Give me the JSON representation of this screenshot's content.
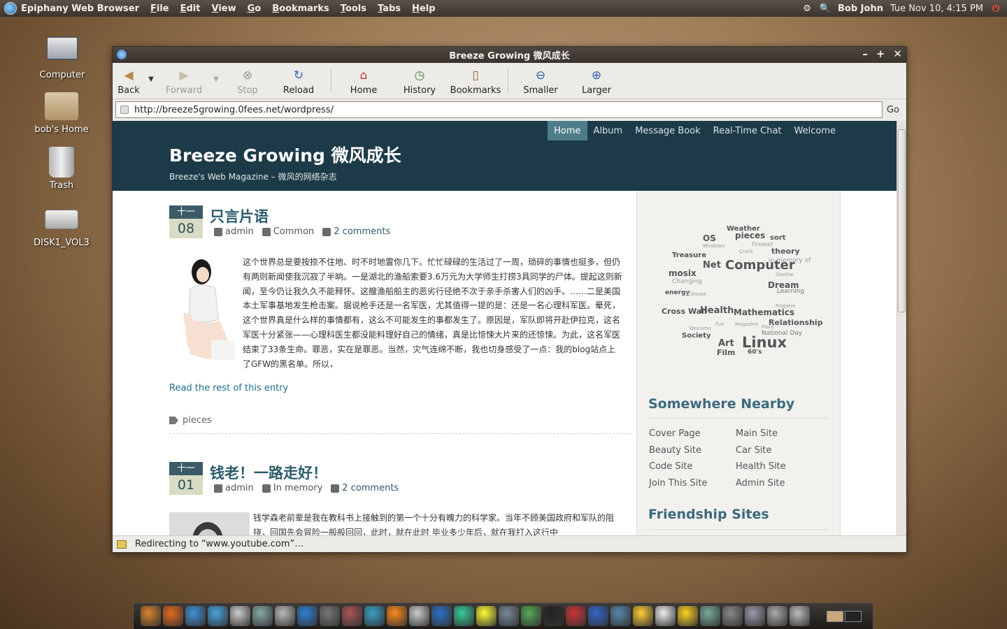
{
  "top_panel": {
    "app_name": "Epiphany Web Browser",
    "menus": [
      "File",
      "Edit",
      "View",
      "Go",
      "Bookmarks",
      "Tools",
      "Tabs",
      "Help"
    ],
    "user": "Bob John",
    "datetime": "Tue Nov 10,  4:15 PM"
  },
  "desktop": {
    "icons": [
      {
        "label": "Computer",
        "icon": "computer-icon"
      },
      {
        "label": "bob's Home",
        "icon": "home-folder-icon"
      },
      {
        "label": "Trash",
        "icon": "trash-icon"
      },
      {
        "label": "DISK1_VOL3",
        "icon": "disk-icon"
      }
    ]
  },
  "window": {
    "title": "Breeze Growing 微风成长",
    "toolbar": {
      "back": "Back",
      "forward": "Forward",
      "stop": "Stop",
      "reload": "Reload",
      "home": "Home",
      "history": "History",
      "bookmarks": "Bookmarks",
      "smaller": "Smaller",
      "larger": "Larger"
    },
    "url": "http://breeze5growing.0fees.net/wordpress/",
    "go_label": "Go",
    "status": "Redirecting to “www.youtube.com”…"
  },
  "site": {
    "title": "Breeze Growing 微风成长",
    "tagline": "Breeze's Web Magazine – 微风的网络杂志",
    "nav": [
      "Home",
      "Album",
      "Message Book",
      "Real-Time Chat",
      "Welcome"
    ],
    "posts": [
      {
        "month": "十一",
        "day": "08",
        "title": "只言片语",
        "author": "admin",
        "category": "Common",
        "comments": "2 comments",
        "body": "这个世界总是要按捺不住地、时不时地雷你几下。忙忙碌碌的生活过了一周，琐碎的事情也挺多，但仍有两则新闻使我沉寂了半晌。一是湖北的渔船索要3.6万元为大学师生打捞3具同学的尸体。提起这则新闻，至今仍让我久久不能释怀。这艘渔船船主的恶劣行径绝不次于亲手杀害人们的凶手。……二是美国本土军事基地发生枪击案。据说枪手还是一名军医，尤其值得一提的是：还是一名心理科军医。晕死，这个世界真是什么样的事情都有，这么不可能发生的事都发生了。原因是，军队即将开赴伊拉克，这名军医十分紧张——心理科医生都没能料理好自己的情绪，真是比惊悚大片来的还惊悚。为此，这名军医结束了33条生命。罪恶，实在是罪恶。当然，灾气连绵不断，我也切身感受了一点：我的blog站点上了GFW的黑名单。所以，",
        "read_more": "Read the rest of this entry",
        "tags": "pieces"
      },
      {
        "month": "十一",
        "day": "01",
        "title": "钱老！一路走好！",
        "author": "admin",
        "category": "In memory",
        "comments": "2 comments",
        "body": "钱学森老前辈是我在教科书上接触到的第一个十分有魄力的科学家。当年不顾美国政府和军队的阻挠，回国先会冒险一般般回回，此时，就在此时 毕业多少年后，就在我打入这行中"
      }
    ],
    "sidebar": {
      "tag_cloud": [
        "Weather",
        "OS",
        "pieces",
        "sort",
        "Firewall",
        "theory",
        "Treasure",
        "Net",
        "Computer",
        "in memory of",
        "mosix",
        "Dream",
        "Learning",
        "energy",
        "Cross Wall",
        "Health",
        "Mathematics",
        "Relationship",
        "National Day",
        "Society",
        "Art",
        "Film",
        "Linux",
        "60's",
        "Changing",
        "Climate",
        "Windows",
        "Crack",
        "Welcome",
        "Fun",
        "Magazine",
        "Plant",
        "Goethe",
        "Problem"
      ],
      "nearby_heading": "Somewhere Nearby",
      "nearby_links": [
        "Cover Page",
        "Main Site",
        "Beauty Site",
        "Car Site",
        "Code Site",
        "Health Site",
        "Join This Site",
        "Admin Site"
      ],
      "friendship_heading": "Friendship Sites"
    }
  },
  "dock": {
    "icons": [
      "settings-icon",
      "firefox-icon",
      "globe-icon",
      "thunderbird-icon",
      "mail-icon",
      "network-icon",
      "photo-icon",
      "plane-icon",
      "game-icon",
      "eye-icon",
      "earth-icon",
      "fish-icon",
      "penguin-icon",
      "globe-icon",
      "chart-icon",
      "qq-icon",
      "chat-icon",
      "people-icon",
      "terminal-icon",
      "pdf-icon",
      "office-icon",
      "browser-icon",
      "notes-icon",
      "text-editor-icon",
      "star-icon",
      "network-tools-icon",
      "usb-icon",
      "monitor-icon",
      "volume-icon",
      "trash-icon"
    ]
  },
  "colors": {
    "site_header": "#1c3a47",
    "nav_active": "#4e7c89",
    "title_link": "#2c5b6b",
    "link": "#1e6c8a"
  }
}
